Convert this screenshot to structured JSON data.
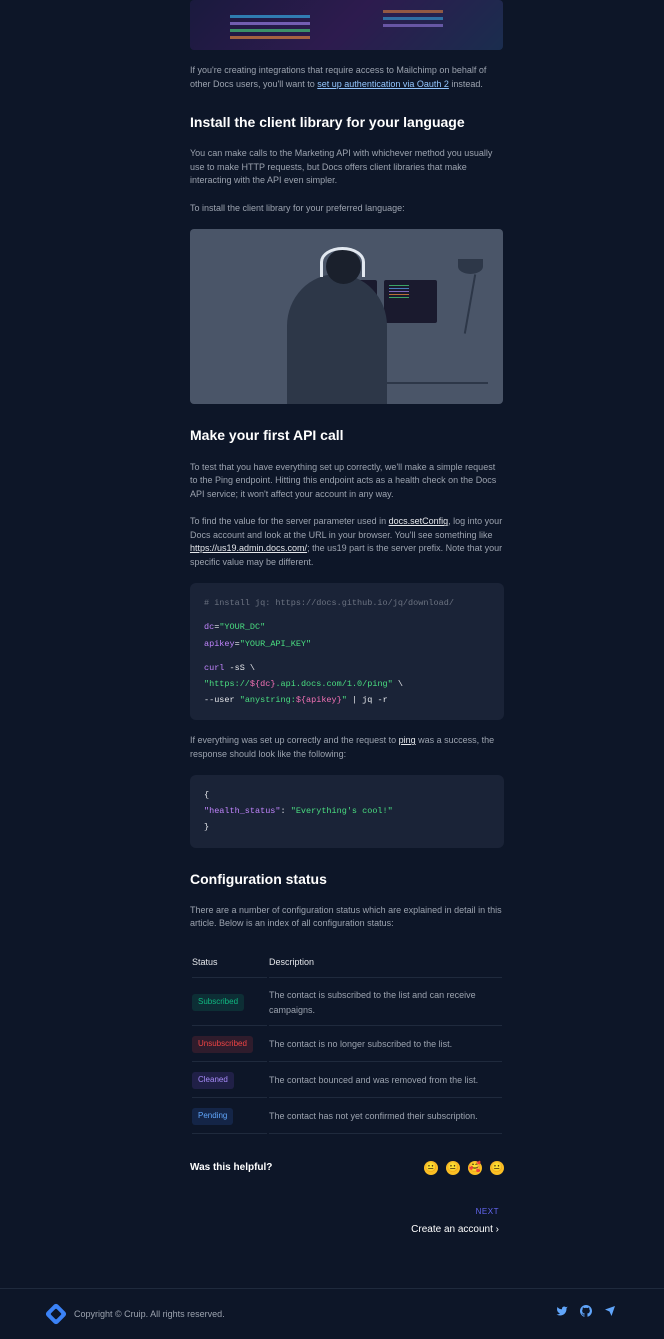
{
  "intro": {
    "p1_before": "If you're creating integrations that require access to Mailchimp on behalf of other Docs users, you'll want to ",
    "oauth_link": "set up authentication via Oauth 2",
    "p1_after": " instead."
  },
  "install": {
    "heading": "Install the client library for your language",
    "p1": "You can make calls to the Marketing API with whichever method you usually use to make HTTP requests, but Docs offers client libraries that make interacting with the API even simpler.",
    "p2": "To install the client library for your preferred language:"
  },
  "first_call": {
    "heading": "Make your first API call",
    "p1": "To test that you have everything set up correctly, we'll make a simple request to the Ping endpoint. Hitting this endpoint acts as a health check on the Docs API service; it won't affect your account in any way.",
    "p2_before": "To find the value for the server parameter used in ",
    "p2_link1": "docs.setConfig",
    "p2_mid": ", log into your Docs account and look at the URL in your browser. You'll see something like ",
    "p2_link2": "https://us19.admin.docs.com/",
    "p2_after": "; the us19 part is the server prefix. Note that your specific value may be different."
  },
  "code1": {
    "l1": "# install jq: https://docs.github.io/jq/download/",
    "l2a": "dc",
    "l2b": "=",
    "l2c": "\"YOUR_DC\"",
    "l3a": "apikey",
    "l3b": "=",
    "l3c": "\"YOUR_API_KEY\"",
    "l4a": "curl",
    "l4b": " -sS \\",
    "l5a": "  \"https://",
    "l5b": "${dc}",
    "l5c": ".api.docs.com/1.0/ping\"",
    "l5d": " \\",
    "l6a": "  --user ",
    "l6b": "\"anystring:",
    "l6c": "${apikey}",
    "l6d": "\"",
    "l6e": " | ",
    "l6f": "jq -r"
  },
  "result": {
    "p_before": "If everything was set up correctly and the request to ",
    "p_link": "ping",
    "p_after": " was a success, the response should look like the following:"
  },
  "code2": {
    "l1": "{",
    "l2a": "  \"health_status\"",
    "l2b": ": ",
    "l2c": "\"Everything's cool!\"",
    "l3": "}"
  },
  "config": {
    "heading": "Configuration status",
    "p1": "There are a number of configuration status which are explained in detail in this article. Below is an index of all configuration status:",
    "th1": "Status",
    "th2": "Description",
    "rows": [
      {
        "status": "Subscribed",
        "cls": "sub",
        "desc": "The contact is subscribed to the list and can receive campaigns."
      },
      {
        "status": "Unsubscribed",
        "cls": "unsub",
        "desc": "The contact is no longer subscribed to the list."
      },
      {
        "status": "Cleaned",
        "cls": "clean",
        "desc": "The contact bounced and was removed from the list."
      },
      {
        "status": "Pending",
        "cls": "pend",
        "desc": "The contact has not yet confirmed their subscription."
      }
    ]
  },
  "helpful": {
    "heading": "Was this helpful?",
    "emojis": [
      "😐",
      "😐",
      "🥰",
      "😐"
    ]
  },
  "next": {
    "label": "NEXT",
    "title": "Create an account  ›"
  },
  "footer": {
    "copyright": "Copyright © Cruip. All rights reserved."
  }
}
